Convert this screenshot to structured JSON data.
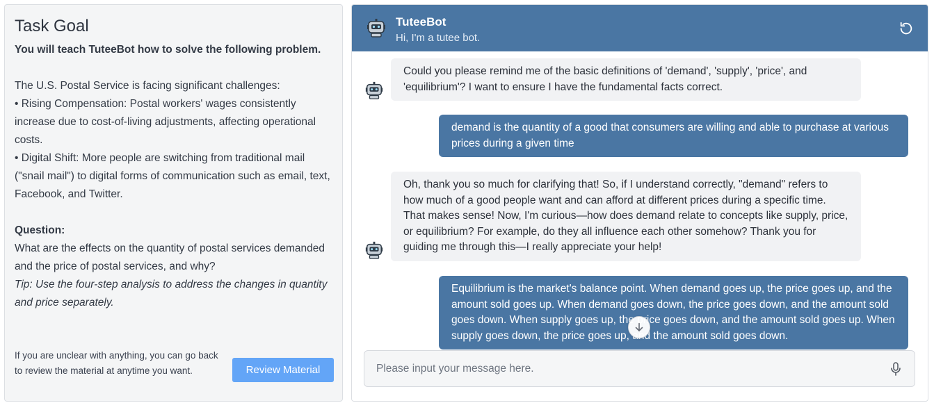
{
  "task": {
    "title": "Task Goal",
    "intro": "You will teach TuteeBot how to solve the following problem.",
    "paragraph": "The U.S. Postal Service is facing significant challenges:",
    "bullets": [
      "•  Rising Compensation: Postal workers' wages consistently increase due to cost-of-living adjustments, affecting operational costs.",
      "•  Digital Shift: More people are switching from traditional mail (\"snail mail\") to digital forms of communication such as email, text, Facebook, and Twitter."
    ],
    "question_label": "Question:",
    "question": "What are the effects on the quantity of postal services demanded and the price of postal services, and why?",
    "tip": "Tip: Use the four-step analysis to address the changes in quantity and price separately.",
    "footer_text": "If you are unclear with anything, you can go back to review the material at anytime you want.",
    "review_button": "Review Material"
  },
  "chat": {
    "bot_name": "TuteeBot",
    "bot_greeting": "Hi, I'm a tutee bot.",
    "messages": [
      {
        "role": "bot",
        "text": "Could you please remind me of the basic definitions of 'demand', 'supply', 'price', and 'equilibrium'? I want to ensure I have the fundamental facts correct."
      },
      {
        "role": "user",
        "text": "demand is the quantity of a good that consumers are willing and able to purchase at various prices during a given time"
      },
      {
        "role": "bot",
        "text": "Oh, thank you so much for clarifying that! So, if I understand correctly, \"demand\" refers to how much of a good people want and can afford at different prices during a specific time. That makes sense! Now, I'm curious—how does demand relate to concepts like supply, price, or equilibrium? For example, do they all influence each other somehow? Thank you for guiding me through this—I really appreciate your help!"
      },
      {
        "role": "user",
        "text": "Equilibrium is the market's balance point. When demand goes up, the price goes up, and the amount sold goes up. When demand goes down, the price goes down, and the amount sold goes down. When supply goes up, the price goes down, and the amount sold goes up. When supply goes down, the price goes up, and the amount sold goes down."
      }
    ],
    "input_placeholder": "Please input your message here.",
    "icons": {
      "bot": "robot-icon",
      "reset": "reset-icon",
      "mic": "microphone-icon",
      "scroll": "arrow-down-icon"
    },
    "colors": {
      "header": "#4a76a3",
      "user_bubble": "#4a76a3",
      "bot_bubble": "#f1f2f4",
      "review_button": "#63a5f7"
    }
  }
}
